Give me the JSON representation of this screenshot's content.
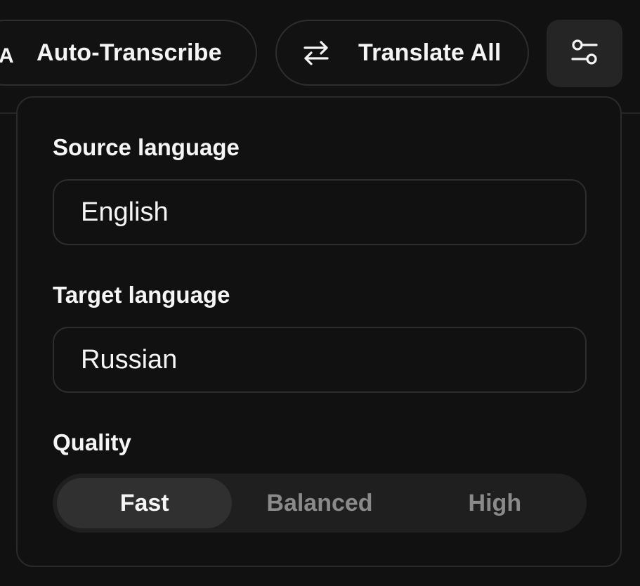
{
  "toolbar": {
    "auto_transcribe": {
      "label": "Auto-Transcribe",
      "icon": "text-size-icon",
      "icon_glyph": "A"
    },
    "translate_all": {
      "label": "Translate All",
      "icon": "swap-arrows-icon"
    },
    "settings": {
      "icon": "sliders-icon",
      "active": true
    }
  },
  "settings_panel": {
    "source_language": {
      "label": "Source language",
      "value": "English"
    },
    "target_language": {
      "label": "Target language",
      "value": "Russian"
    },
    "quality": {
      "label": "Quality",
      "options": [
        "Fast",
        "Balanced",
        "High"
      ],
      "selected": "Fast"
    }
  },
  "colors": {
    "background": "#111111",
    "border": "#2e2e2e",
    "active_segment": "#303030",
    "inactive_text": "#8a8a8a",
    "text": "#f5f5f5"
  }
}
